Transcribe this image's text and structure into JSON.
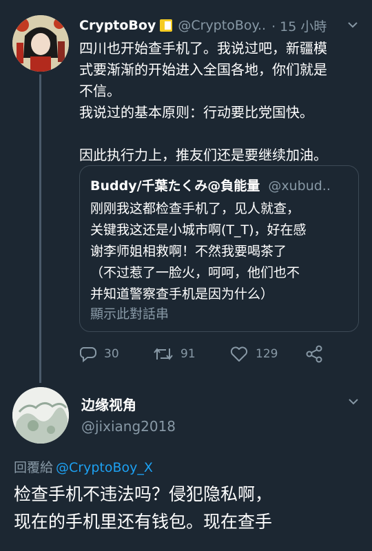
{
  "tweet": {
    "author_name": "CryptoBoy",
    "author_handle": "@CryptoBoy..",
    "time": "· 15 小時",
    "lines": [
      "四川也开始查手机了。我说过吧，新疆模",
      "式要渐渐的开始进入全国各地，你们就是",
      "不信。",
      "我说过的基本原则：行动要比党国快。",
      "",
      "因此执行力上，推友们还是要继续加油。"
    ],
    "quote": {
      "author_name": "Buddy/千葉たくみ@負能量",
      "author_handle": "@xubud..",
      "lines": [
        "刚刚我这都检查手机了，见人就查，",
        "关键我这还是小城市啊(T_T)，好在感",
        "谢李师姐相救啊！不然我要喝茶了",
        "（不过惹了一脸火，呵呵，他们也不",
        "并知道警察查手机是因为什么）"
      ],
      "show_thread": "顯示此對話串"
    },
    "actions": {
      "replies": "30",
      "retweets": "91",
      "likes": "129"
    }
  },
  "reply": {
    "author_name": "边缘视角",
    "author_handle": "@jixiang2018",
    "replying_to_label": "回覆給",
    "replying_to_handle": "@CryptoBoy_X",
    "lines": [
      "检查手机不违法吗？侵犯隐私啊，",
      "现在的手机里还有钱包。现在查手"
    ]
  },
  "icons": {
    "reply": "reply-icon",
    "retweet": "retweet-icon",
    "like": "heart-icon",
    "share": "share-icon",
    "more": "chevron-down-icon",
    "badge": "flag-badge-icon"
  },
  "colors": {
    "background": "#1c2732",
    "secondary_text": "#8899a6",
    "link": "#1da1f2",
    "badge": "#f5cc24"
  }
}
